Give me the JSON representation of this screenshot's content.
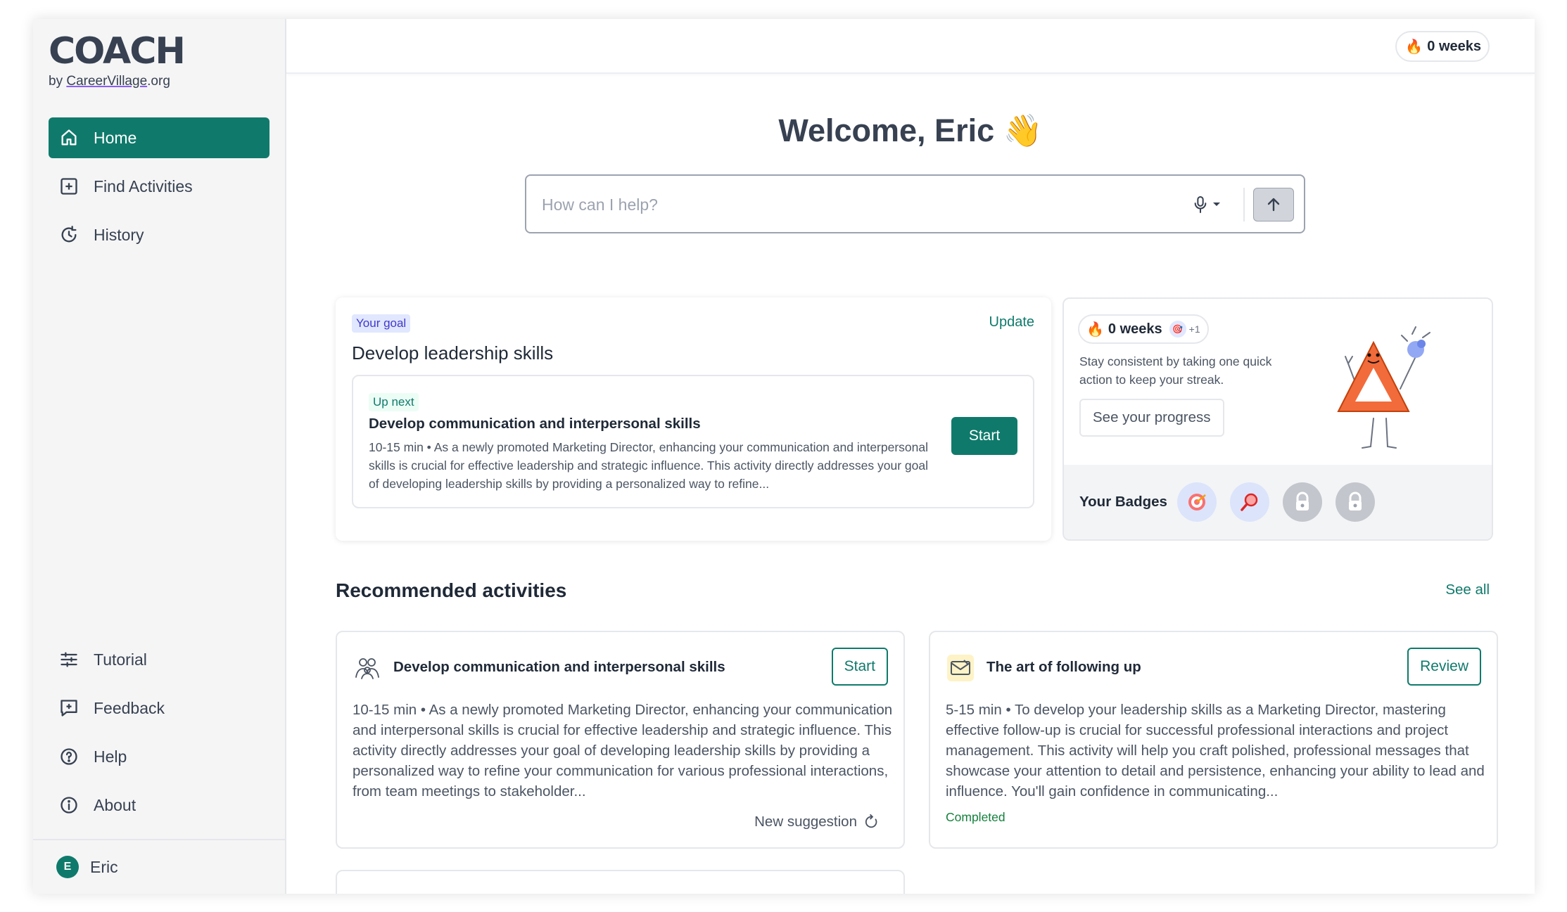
{
  "brand": {
    "name": "COACH",
    "by": "by ",
    "org": "CareerVillage",
    "suffix": ".org"
  },
  "sidebar": {
    "top_items": [
      {
        "label": "Home",
        "icon": "home-icon",
        "active": true
      },
      {
        "label": "Find Activities",
        "icon": "plus-square-icon"
      },
      {
        "label": "History",
        "icon": "history-icon"
      }
    ],
    "bottom_items": [
      {
        "label": "Tutorial",
        "icon": "sliders-icon"
      },
      {
        "label": "Feedback",
        "icon": "feedback-icon"
      },
      {
        "label": "Help",
        "icon": "help-circle-icon"
      },
      {
        "label": "About",
        "icon": "info-icon"
      }
    ],
    "user": {
      "initial": "E",
      "name": "Eric"
    }
  },
  "topbar": {
    "streak": "0 weeks"
  },
  "welcome": {
    "text": "Welcome, Eric",
    "emoji": "👋"
  },
  "search": {
    "placeholder": "How can I help?",
    "value": ""
  },
  "goal": {
    "tag": "Your goal",
    "update": "Update",
    "title": "Develop leadership skills",
    "up_next": {
      "tag": "Up next",
      "title": "Develop communication and interpersonal skills",
      "desc": "10-15 min • As a newly promoted Marketing Director, enhancing your communication and interpersonal skills is crucial for effective leadership and strategic influence. This activity directly addresses your goal of developing leadership skills by providing a personalized way to refine...",
      "button": "Start"
    }
  },
  "streak_card": {
    "streak": "0 weeks",
    "plus": "+1",
    "text": "Stay consistent by taking one quick action to keep your streak.",
    "button": "See your progress",
    "badges_label": "Your Badges",
    "badges": [
      "target-badge",
      "magnifier-badge",
      "locked-badge",
      "locked-badge"
    ]
  },
  "recommended": {
    "title": "Recommended activities",
    "see_all": "See all",
    "cards": [
      {
        "title": "Develop communication and interpersonal skills",
        "button": "Start",
        "desc": "10-15 min • As a newly promoted Marketing Director, enhancing your communication and interpersonal skills is crucial for effective leadership and strategic influence. This activity directly addresses your goal of developing leadership skills by providing a personalized way to refine your communication for various professional interactions, from team meetings to stakeholder...",
        "footer": "New suggestion"
      },
      {
        "title": "The art of following up",
        "button": "Review",
        "desc": "5-15 min • To develop your leadership skills as a Marketing Director, mastering effective follow-up is crucial for successful professional interactions and project management. This activity will help you craft polished, professional messages that showcase your attention to detail and persistence, enhancing your ability to lead and influence. You'll gain confidence in communicating...",
        "status": "Completed"
      }
    ]
  },
  "colors": {
    "accent": "#0f7a6b",
    "flame": "#ea580c",
    "goal_tag_bg": "#e0e7ff"
  }
}
